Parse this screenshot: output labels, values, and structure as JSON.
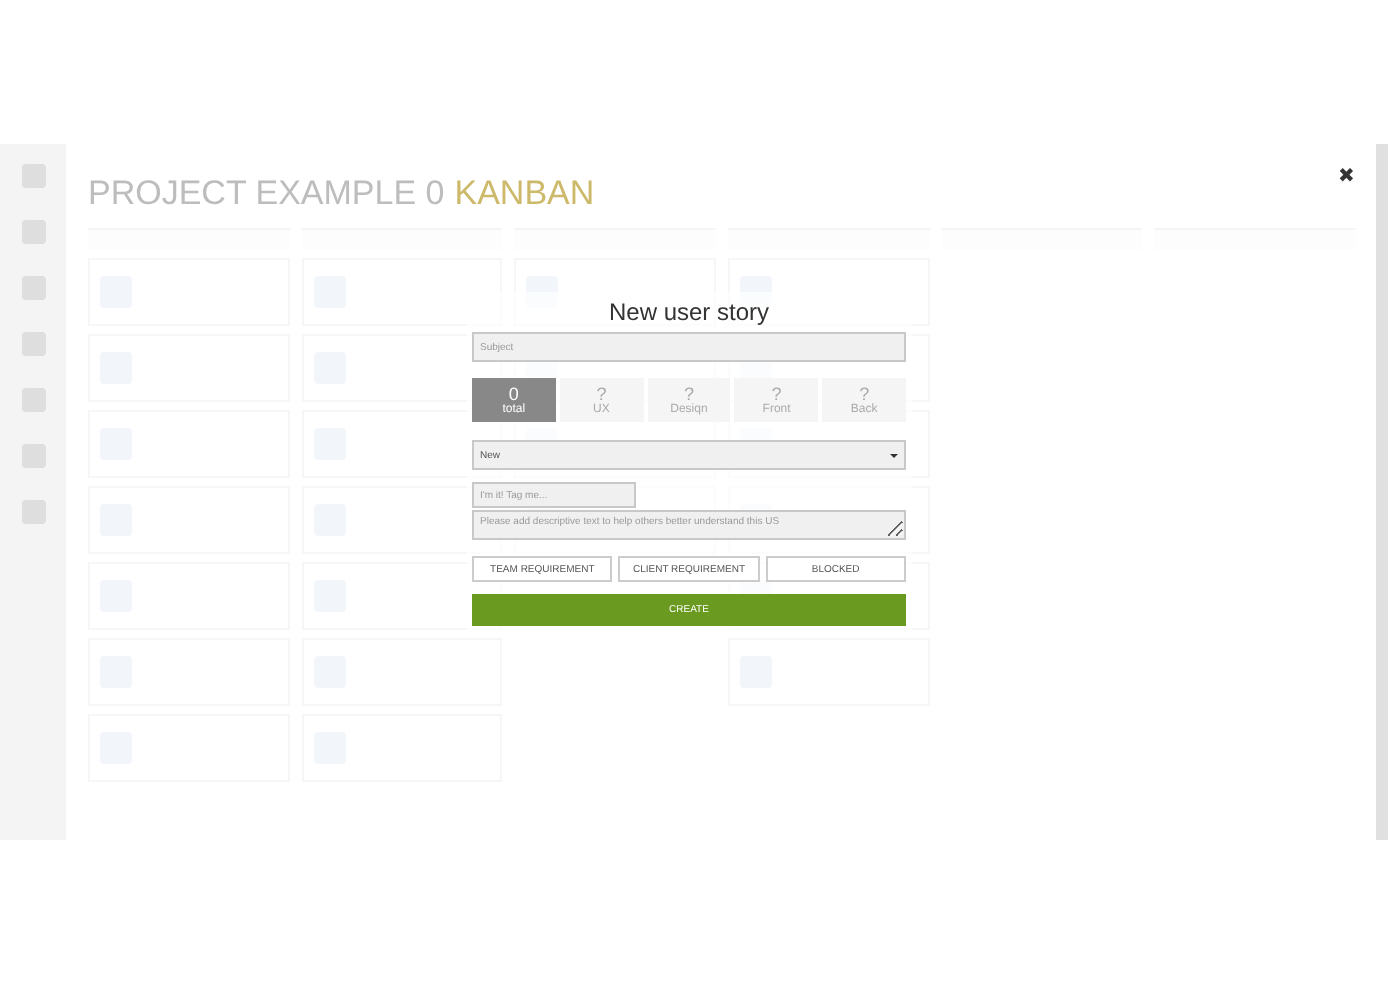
{
  "page": {
    "project_name": "PROJECT EXAMPLE 0",
    "board_label": "KANBAN"
  },
  "dialog": {
    "title": "New user story",
    "close_icon": "✖",
    "subject": {
      "placeholder": "Subject"
    },
    "points": [
      {
        "value": "0",
        "label": "total",
        "selected": true
      },
      {
        "value": "?",
        "label": "UX",
        "selected": false
      },
      {
        "value": "?",
        "label": "Desiqn",
        "selected": false
      },
      {
        "value": "?",
        "label": "Front",
        "selected": false
      },
      {
        "value": "?",
        "label": "Back",
        "selected": false
      }
    ],
    "status": {
      "value": "New"
    },
    "tags": {
      "placeholder": "I'm it! Tag me..."
    },
    "description": {
      "placeholder": "Please add descriptive text to help others better understand this US"
    },
    "toggles": [
      {
        "label": "TEAM REQUIREMENT",
        "selected": false
      },
      {
        "label": "CLIENT REQUIREMENT",
        "selected": false
      },
      {
        "label": "BLOCKED",
        "selected": false
      }
    ],
    "create_button": "CREATE"
  }
}
